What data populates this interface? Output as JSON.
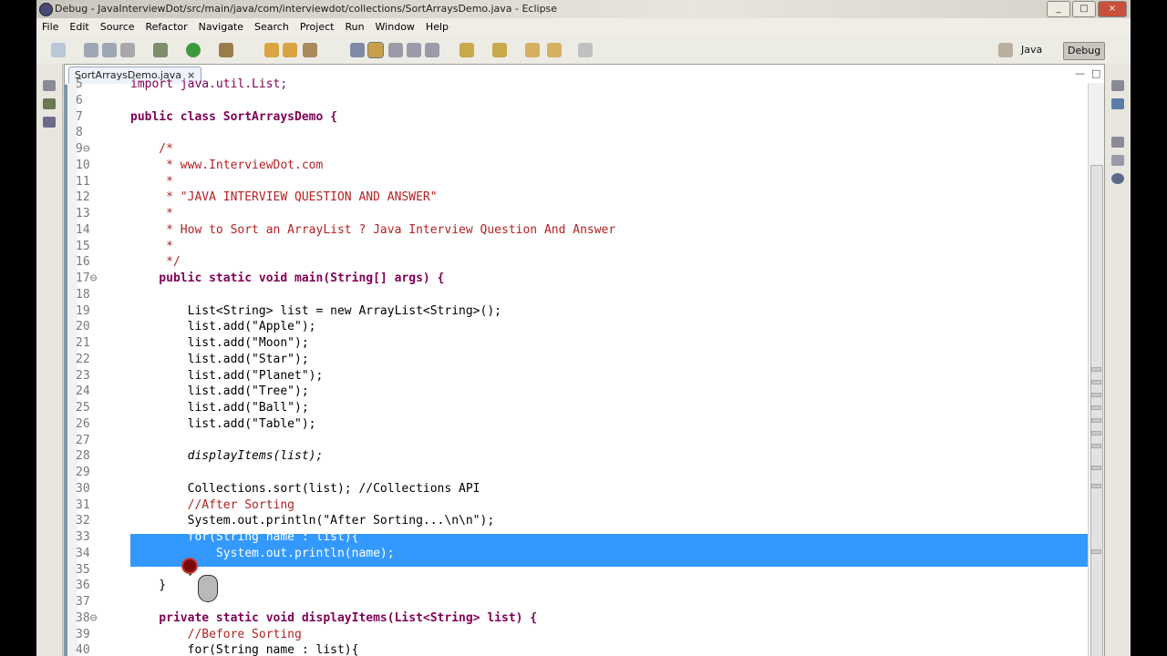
{
  "window": {
    "title": "Debug - JavaInterviewDot/src/main/java/com/interviewdot/collections/SortArraysDemo.java - Eclipse",
    "controls": [
      "_",
      "□",
      "×"
    ]
  },
  "menu": [
    "File",
    "Edit",
    "Source",
    "Refactor",
    "Navigate",
    "Search",
    "Project",
    "Run",
    "Window",
    "Help"
  ],
  "toolbar": {
    "perspectives": [
      "Java",
      "Debug"
    ]
  },
  "editor": {
    "tab_label": "SortArraysDemo.java",
    "tab_close": "×",
    "view_controls": [
      "—",
      "□"
    ]
  },
  "code": {
    "line_numbers": [
      "5",
      "6",
      "7",
      "8",
      "9⊖",
      "10",
      "11",
      "12",
      "13",
      "14",
      "15",
      "16",
      "17⊖",
      "18",
      "19",
      "20",
      "21",
      "22",
      "23",
      "24",
      "25",
      "26",
      "27",
      "28",
      "29",
      "30",
      "31",
      "32",
      "33",
      "34",
      "35",
      "36",
      "37",
      "38⊖",
      "39",
      "40"
    ],
    "lines": [
      "import java.util.List;",
      "",
      "public class SortArraysDemo {",
      "",
      "    /*",
      "     * www.InterviewDot.com",
      "     *",
      "     * \"JAVA INTERVIEW QUESTION AND ANSWER\"",
      "     *",
      "     * How to Sort an ArrayList ? Java Interview Question And Answer",
      "     *",
      "     */",
      "    public static void main(String[] args) {",
      "",
      "        List<String> list = new ArrayList<String>();",
      "        list.add(\"Apple\");",
      "        list.add(\"Moon\");",
      "        list.add(\"Star\");",
      "        list.add(\"Planet\");",
      "        list.add(\"Tree\");",
      "        list.add(\"Ball\");",
      "        list.add(\"Table\");",
      "",
      "        displayItems(list);",
      "",
      "        Collections.sort(list); //Collections API",
      "        //After Sorting",
      "        System.out.println(\"After Sorting...\\n\\n\");",
      "        for(String name : list){",
      "            System.out.println(name);",
      "        }",
      "    }",
      "",
      "    private static void displayItems(List<String> list) {",
      "        //Before Sorting",
      "        for(String name : list){"
    ]
  },
  "colors": {
    "keyword": "#7f0055",
    "comment": "#b22222",
    "string": "#2a00ff",
    "selection": "#3399ff"
  }
}
